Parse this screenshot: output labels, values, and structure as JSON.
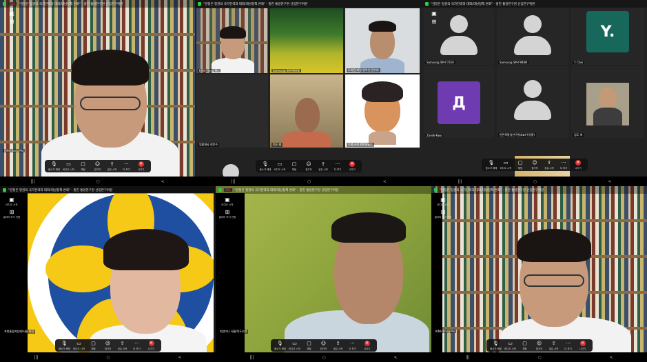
{
  "panels": [
    {
      "title": "\"김정은 정권의 국가전략과 대외/대남정책 변화\" - 충진 통일연구원 선임연구위원",
      "rec": "REC",
      "name": "KINU Kong Mo",
      "sidebar": [
        {
          "icon": "camera-icon",
          "label": ""
        },
        {
          "icon": "grid-icon",
          "label": ""
        }
      ]
    },
    {
      "title": "\"김정은 정권의 국가전략과 대외/대남정책 변화\" - 충진 통일연구원 선임연구위원",
      "tiles": [
        {
          "name": "KINU Hong Mo"
        },
        {
          "name": "Samsung SM-N9XN"
        },
        {
          "name": "도희윤(피랍·탈북인권연대)"
        },
        {
          "name": "임흥재사 정운수"
        },
        {
          "name": "지도 회"
        },
        {
          "name": "부평/서해 평화예술인"
        }
      ]
    },
    {
      "title": "\"김정은 정권의 국가전략과 대외/대남정책 변화\" - 충진 통일연구원 선임연구위원",
      "tiles": [
        {
          "name": "Samsung SM-F7316"
        },
        {
          "name": "Samsung SM-F946N"
        },
        {
          "name": "Y. Choi",
          "letter": "Y."
        },
        {
          "name": "Zavidi-Kwo",
          "letter": "Д"
        },
        {
          "name": "한민족통일연구원대표(우강평)"
        },
        {
          "name": "김도 희"
        }
      ]
    },
    {
      "title": "\"김정은 정권의 국가전략과 대외/대남정책 변화\" - 충진 통일연구원 선임연구위원",
      "name": "포천통일여성회/서울 회장",
      "sidebar": [
        {
          "icon": "camera-icon",
          "label": "비디오 시작"
        },
        {
          "icon": "grid-icon",
          "label": "갤러리 보기 전환"
        }
      ]
    },
    {
      "title": "\"김정은 정권의 국가전략과 대외/대남정책 변화\" - 충진 통일연구원 선임연구위원",
      "rec": "REC",
      "name": "미얀마나 서울/육도리만",
      "sidebar": [
        {
          "icon": "camera-icon",
          "label": "비디오 시작"
        },
        {
          "icon": "grid-icon",
          "label": "갤러리 보기 전환"
        }
      ]
    },
    {
      "title": "\"김정은 정권의 국가전략과 대외/대남정책 변화\" - 충진 통일연구원 선임연구위원",
      "name": "KINU Kong Mo",
      "sidebar": [
        {
          "icon": "camera-icon",
          "label": "비디오 시작"
        },
        {
          "icon": "grid-icon",
          "label": "갤러리 보기 전환"
        }
      ]
    }
  ],
  "toolbar": [
    {
      "icon": "mic-icon",
      "label": "음소거 해제"
    },
    {
      "icon": "video-icon",
      "label": "비디오 시작"
    },
    {
      "icon": "chat-icon",
      "label": "채팅"
    },
    {
      "icon": "participants-icon",
      "label": "참가자"
    },
    {
      "icon": "share-icon",
      "label": "공유 시작"
    },
    {
      "icon": "more-icon",
      "label": "더 보기"
    },
    {
      "icon": "leave-icon",
      "label": "나가기"
    }
  ],
  "nav": {
    "recent": "|||",
    "home": "○",
    "back": "<"
  }
}
